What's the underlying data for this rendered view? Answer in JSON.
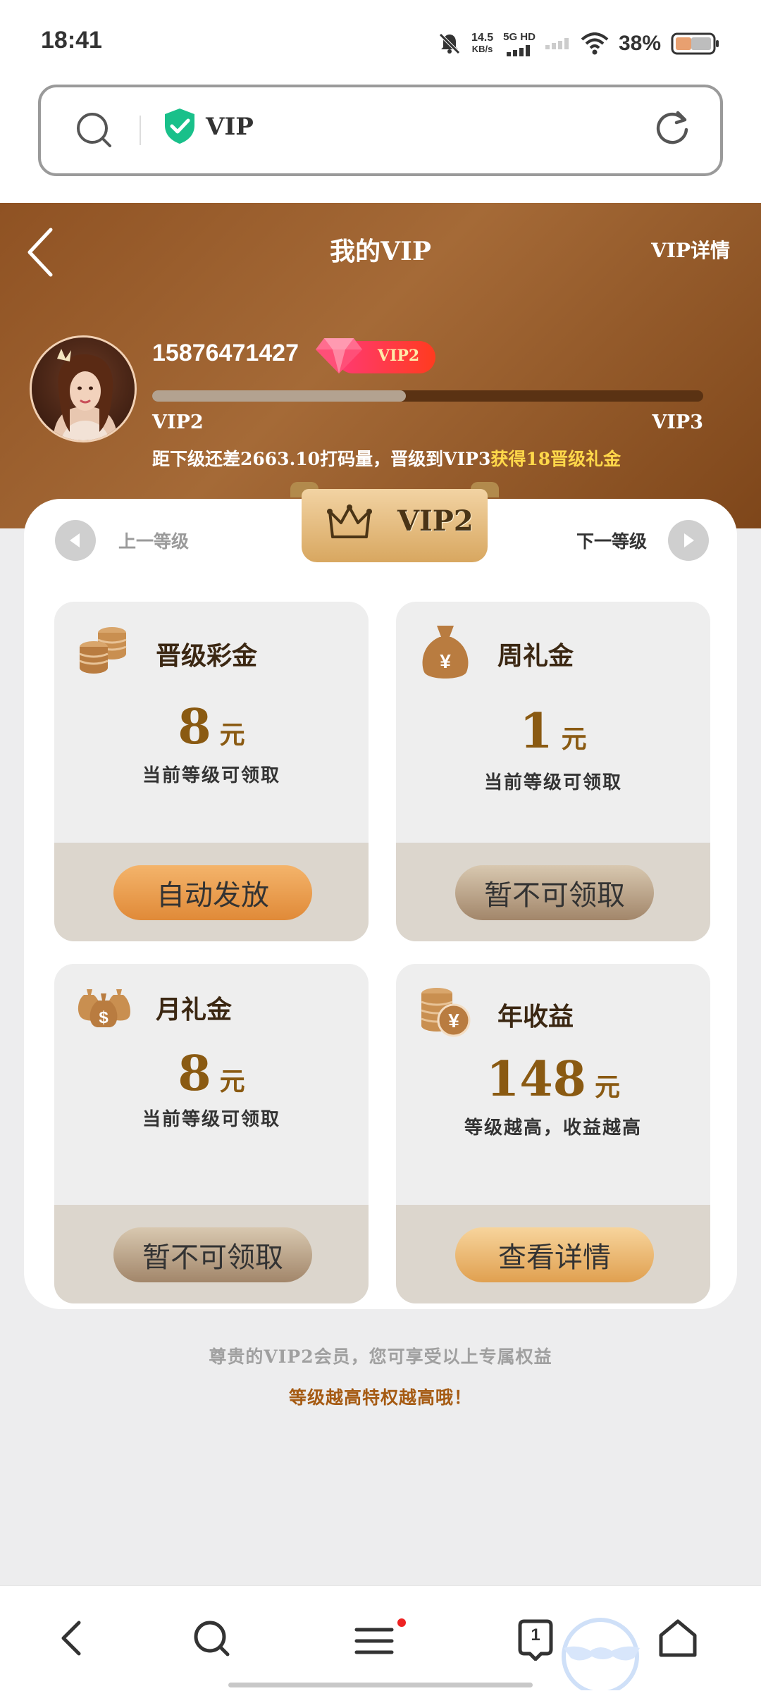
{
  "status_bar": {
    "time": "18:41",
    "net_speed_value": "14.5",
    "net_speed_unit": "KB/s",
    "network_type": "5G HD",
    "battery_percent": "38%"
  },
  "address_bar": {
    "text": "VIP"
  },
  "header": {
    "title": "我的VIP",
    "detail_link": "VIP详情",
    "phone": "15876471427",
    "badge": "VIP2",
    "progress": 0.46,
    "level_current": "VIP2",
    "level_next": "VIP3",
    "upgrade_text": "距下级还差2663.10打码量，晋级到VIP3",
    "upgrade_reward": "获得18晋级礼金"
  },
  "level_selector": {
    "prev_label": "上一等级",
    "next_label": "下一等级",
    "current": "VIP2"
  },
  "benefits": [
    {
      "title": "晋级彩金",
      "amount": "8",
      "unit": "元",
      "sub": "当前等级可领取",
      "button": "自动发放",
      "icon": "coins-stack-icon"
    },
    {
      "title": "周礼金",
      "amount": "1",
      "unit": "元",
      "sub": "当前等级可领取",
      "button": "暂不可领取",
      "icon": "money-bag-icon"
    },
    {
      "title": "月礼金",
      "amount": "8",
      "unit": "元",
      "sub": "当前等级可领取",
      "button": "暂不可领取",
      "icon": "money-bags-icon"
    },
    {
      "title": "年收益",
      "amount": "148",
      "unit": "元",
      "sub": "等级越高，收益越高",
      "button": "查看详情",
      "icon": "coin-yen-icon"
    }
  ],
  "footer": {
    "note": "尊贵的VIP2会员，您可享受以上专属权益",
    "highlight": "等级越高特权越高哦！"
  },
  "bottom_nav": {
    "tab_count": "1"
  },
  "colors": {
    "header_brown": "#8f5223",
    "accent_gold": "#ffd84a",
    "amount_brown": "#8a5a12",
    "badge_red": "#ff3a73"
  }
}
